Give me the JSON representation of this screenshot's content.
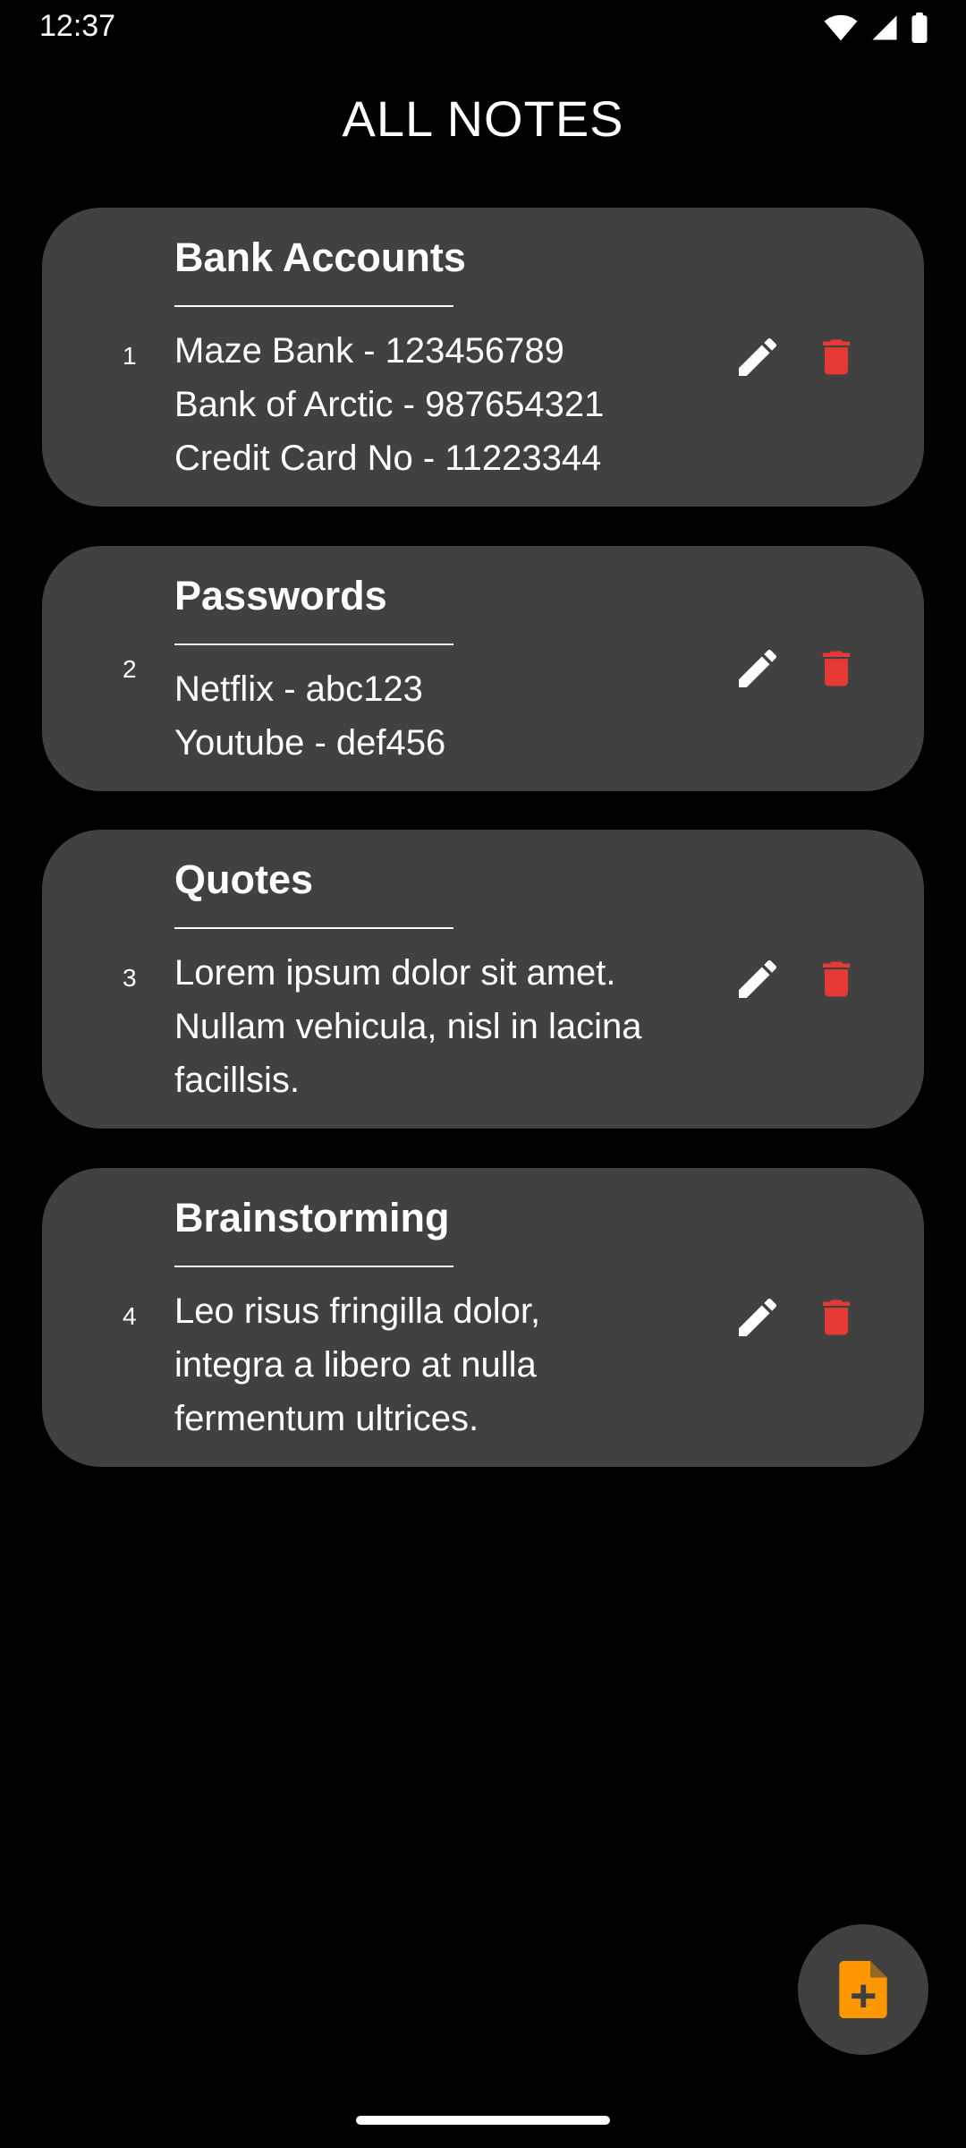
{
  "status_bar": {
    "time": "12:37"
  },
  "header": {
    "title": "ALL NOTES"
  },
  "notes": [
    {
      "index": "1",
      "title": "Bank Accounts",
      "lines": [
        "Maze Bank - 123456789",
        "Bank of Arctic - 987654321",
        "Credit Card No - 11223344"
      ]
    },
    {
      "index": "2",
      "title": "Passwords",
      "lines": [
        "Netflix - abc123",
        "Youtube - def456"
      ]
    },
    {
      "index": "3",
      "title": "Quotes",
      "lines": [
        "Lorem ipsum dolor sit amet.",
        "Nullam vehicula, nisl in lacina",
        "facillsis."
      ]
    },
    {
      "index": "4",
      "title": "Brainstorming",
      "lines": [
        "Leo risus fringilla dolor,",
        "integra a libero at nulla",
        "fermentum ultrices."
      ]
    }
  ],
  "icons": {
    "edit": "pencil-icon",
    "delete": "trash-icon",
    "add_note": "note-add-icon"
  },
  "colors": {
    "background": "#000000",
    "card": "#414141",
    "delete_accent": "#e53935",
    "fab_icon": "#ff9800"
  }
}
